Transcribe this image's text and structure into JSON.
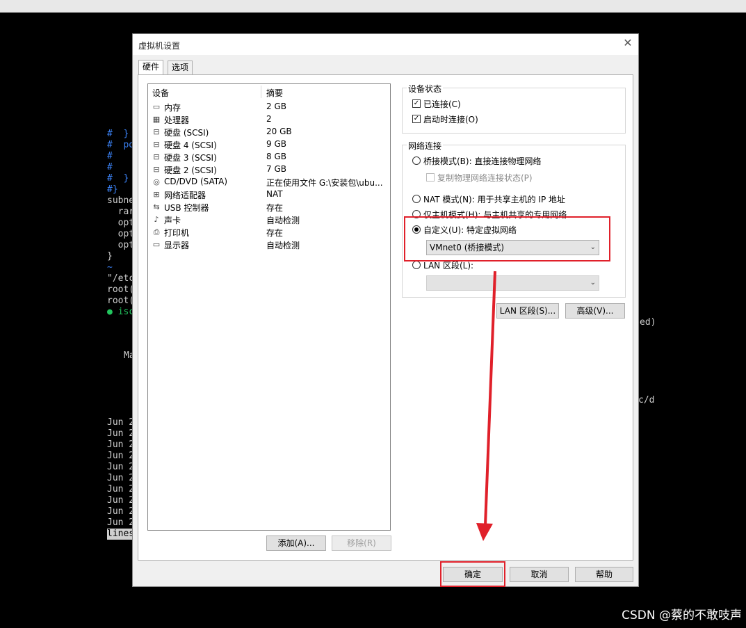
{
  "terminal": {
    "lines": [
      {
        "text": "#  }",
        "cls": "blue"
      },
      {
        "text": "#  po",
        "cls": "blue"
      },
      {
        "text": "#",
        "cls": "blue"
      },
      {
        "text": "#",
        "cls": "blue"
      },
      {
        "text": "#  }",
        "cls": "blue"
      },
      {
        "text": "#}",
        "cls": "blue"
      },
      {
        "text": "subne",
        "cls": ""
      },
      {
        "text": "  rar",
        "cls": ""
      },
      {
        "text": "  opt",
        "cls": ""
      },
      {
        "text": "  opt",
        "cls": ""
      },
      {
        "text": "  opt",
        "cls": ""
      },
      {
        "text": "}",
        "cls": ""
      },
      {
        "text": "~",
        "cls": "blue"
      },
      {
        "text": "\"/etc",
        "cls": ""
      },
      {
        "text": "root(",
        "cls": ""
      },
      {
        "text": "root(",
        "cls": ""
      },
      {
        "text": "● isc",
        "cls": "green"
      }
    ],
    "ma_line": "Ma",
    "jun_lines": [
      "Jun 2",
      "Jun 2",
      "Jun 2",
      "Jun 2",
      "Jun 2",
      "Jun 2",
      "Jun 2",
      "Jun 2",
      "Jun 2",
      "Jun 2"
    ],
    "lines_label": "lines",
    "right_fragment_1": "ed)",
    "right_fragment_2": "c/d"
  },
  "dialog": {
    "title": "虚拟机设置",
    "close_glyph": "✕",
    "tabs": [
      "硬件",
      "选项"
    ],
    "device_list": {
      "header_device": "设备",
      "header_summary": "摘要",
      "rows": [
        {
          "icon": "▭",
          "name": "内存",
          "summary": "2 GB"
        },
        {
          "icon": "▦",
          "name": "处理器",
          "summary": "2"
        },
        {
          "icon": "⊟",
          "name": "硬盘 (SCSI)",
          "summary": "20 GB"
        },
        {
          "icon": "⊟",
          "name": "硬盘 4 (SCSI)",
          "summary": "9 GB"
        },
        {
          "icon": "⊟",
          "name": "硬盘 3 (SCSI)",
          "summary": "8 GB"
        },
        {
          "icon": "⊟",
          "name": "硬盘 2 (SCSI)",
          "summary": "7 GB"
        },
        {
          "icon": "◎",
          "name": "CD/DVD (SATA)",
          "summary": "正在使用文件 G:\\安装包\\ubu..."
        },
        {
          "icon": "⊞",
          "name": "网络适配器",
          "summary": "NAT"
        },
        {
          "icon": "⇆",
          "name": "USB 控制器",
          "summary": "存在"
        },
        {
          "icon": "♪",
          "name": "声卡",
          "summary": "自动检测"
        },
        {
          "icon": "⎙",
          "name": "打印机",
          "summary": "存在"
        },
        {
          "icon": "▭",
          "name": "显示器",
          "summary": "自动检测"
        }
      ]
    },
    "add_button": "添加(A)...",
    "remove_button": "移除(R)",
    "device_status": {
      "label": "设备状态",
      "connected": "已连接(C)",
      "connect_at_power_on": "启动时连接(O)",
      "check_glyph": "✓"
    },
    "network": {
      "label": "网络连接",
      "bridged": "桥接模式(B): 直接连接物理网络",
      "replicate": "复制物理网络连接状态(P)",
      "nat": "NAT 模式(N): 用于共享主机的 IP 地址",
      "host_only": "仅主机模式(H): 与主机共享的专用网络",
      "custom": "自定义(U): 特定虚拟网络",
      "custom_value": "VMnet0 (桥接模式)",
      "lan_segment": "LAN 区段(L):",
      "lan_value": "",
      "selected": "custom"
    },
    "lan_segments_button": "LAN 区段(S)...",
    "advanced_button": "高级(V)...",
    "ok_button": "确定",
    "cancel_button": "取消",
    "help_button": "帮助",
    "dropdown_arrow": "⌄"
  },
  "watermark": "CSDN @蔡的不敢吱声",
  "colors": {
    "highlight_red": "#e0202a"
  }
}
